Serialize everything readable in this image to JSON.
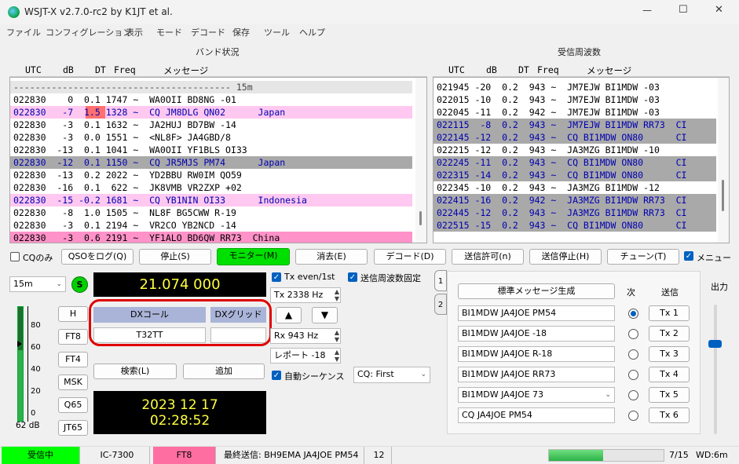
{
  "window": {
    "title": "WSJT-X   v2.7.0-rc2   by K1JT et al.",
    "minimize": "—",
    "maximize": "☐",
    "close": "✕"
  },
  "menu": [
    "ファイル",
    "コンフィグレーション",
    "表示",
    "モード",
    "デコード",
    "保存",
    "ツール",
    "ヘルプ"
  ],
  "band_activity": {
    "title": "バンド状況",
    "headers": [
      "UTC",
      "dB",
      "DT",
      "Freq",
      "メッセージ"
    ],
    "separator": "---------------------------------------- 15m",
    "rows": [
      {
        "text": "022830    0  0.1 1747 ~  WA0OII BD8NG -01",
        "hl": "none"
      },
      {
        "text": "022830   -7  1.5 1328 ~  CQ JM8DLG QN02      Japan",
        "hl": "pink",
        "dt_red": true
      },
      {
        "text": "022830   -3  0.1 1632 ~  JA2HUJ BD7BW -14",
        "hl": "none"
      },
      {
        "text": "022830   -3  0.0 1551 ~  <NL8F> JA4GBD/8",
        "hl": "none"
      },
      {
        "text": "022830  -13  0.1 1041 ~  WA0OII YF1BLS OI33",
        "hl": "none"
      },
      {
        "text": "022830  -12  0.1 1150 ~  CQ JR5MJS PM74      Japan",
        "hl": "gray"
      },
      {
        "text": "022830  -13  0.2 2022 ~  YD2BBU RW0IM QO59",
        "hl": "none"
      },
      {
        "text": "022830  -16  0.1  622 ~  JK8VMB VR2ZXP +02",
        "hl": "none"
      },
      {
        "text": "022830  -15 -0.2 1681 ~  CQ YB1NIN OI33      Indonesia",
        "hl": "pink"
      },
      {
        "text": "022830   -8  1.0 1505 ~  NL8F BG5CWW R-19",
        "hl": "none"
      },
      {
        "text": "022830   -3  0.1 2194 ~  VR2CO YB2NCD -14",
        "hl": "none"
      },
      {
        "text": "022830   -3  0.6 2191 ~  YF1ALO BD6QW RR73  China",
        "hl": "hotpink"
      }
    ]
  },
  "rx_frequency": {
    "title": "受信周波数",
    "headers": [
      "UTC",
      "dB",
      "DT",
      "Freq",
      "メッセージ"
    ],
    "rows": [
      {
        "text": "021945 -20  0.2  943 ~  JM7EJW BI1MDW -03",
        "hl": "none"
      },
      {
        "text": "022015 -10  0.2  943 ~  JM7EJW BI1MDW -03",
        "hl": "none"
      },
      {
        "text": "022045 -11  0.2  942 ~  JM7EJW BI1MDW -03",
        "hl": "none"
      },
      {
        "text": "022115  -8  0.2  943 ~  JM7EJW BI1MDW RR73  CI",
        "hl": "gray"
      },
      {
        "text": "022145 -12  0.2  943 ~  CQ BI1MDW ON80      CI",
        "hl": "gray"
      },
      {
        "text": "022215 -12  0.2  943 ~  JA3MZG BI1MDW -10",
        "hl": "none"
      },
      {
        "text": "022245 -11  0.2  943 ~  CQ BI1MDW ON80      CI",
        "hl": "gray"
      },
      {
        "text": "022315 -14  0.2  943 ~  CQ BI1MDW ON80      CI",
        "hl": "gray"
      },
      {
        "text": "022345 -10  0.2  943 ~  JA3MZG BI1MDW -12",
        "hl": "none"
      },
      {
        "text": "022415 -16  0.2  942 ~  JA3MZG BI1MDW RR73  CI",
        "hl": "gray"
      },
      {
        "text": "022445 -12  0.2  943 ~  JA3MZG BI1MDW RR73  CI",
        "hl": "gray"
      },
      {
        "text": "022515 -15  0.2  943 ~  CQ BI1MDW ON80      CI",
        "hl": "gray"
      }
    ]
  },
  "controls": {
    "cq_only": "CQのみ",
    "log_qso": "QSOをログ(Q)",
    "stop": "停止(S)",
    "monitor": "モニター(M)",
    "erase": "消去(E)",
    "decode": "デコード(D)",
    "enable_tx": "送信許可(n)",
    "halt_tx": "送信停止(H)",
    "tune": "チューン(T)",
    "menus": "メニュー"
  },
  "band": "15m",
  "status_dot": "S",
  "frequency": "21.074 000",
  "meter": {
    "ticks": [
      "80",
      "60",
      "40",
      "20",
      "0"
    ],
    "db": "62 dB",
    "level_pct": 62
  },
  "mode_buttons": [
    "H",
    "FT8",
    "FT4",
    "MSK",
    "Q65",
    "JT65"
  ],
  "dx": {
    "call_label": "DXコール",
    "grid_label": "DXグリッド",
    "call": "T32TT",
    "grid": ""
  },
  "lookup": "検索(L)",
  "add": "追加",
  "date": "2023 12 17",
  "time": "02:28:52",
  "tx_even": "Tx even/1st",
  "hold_tx": "送信周波数固定",
  "tx_freq": "Tx  2338  Hz",
  "rx_freq": "Rx  943  Hz",
  "report": "レポート -18",
  "auto_seq": "自動シーケンス",
  "cq_select": "CQ: First",
  "tabs": [
    "1",
    "2"
  ],
  "generate": "標準メッセージ生成",
  "next": "次",
  "send": "送信",
  "messages": [
    {
      "text": "BI1MDW JA4JOE PM54",
      "tx": "Tx 1",
      "selected": true
    },
    {
      "text": "BI1MDW JA4JOE -18",
      "tx": "Tx 2",
      "selected": false
    },
    {
      "text": "BI1MDW JA4JOE R-18",
      "tx": "Tx 3",
      "selected": false
    },
    {
      "text": "BI1MDW JA4JOE RR73",
      "tx": "Tx 4",
      "selected": false
    },
    {
      "text": "BI1MDW JA4JOE 73",
      "tx": "Tx 5",
      "selected": false
    },
    {
      "text": "CQ JA4JOE PM54",
      "tx": "Tx 6",
      "selected": false
    }
  ],
  "power_label": "出力",
  "statusbar": {
    "receiving": "受信中",
    "rig": "IC-7300",
    "mode": "FT8",
    "last_tx": "最終送信: BH9EMA JA4JOE PM54",
    "count": "12",
    "progress": "7/15",
    "wd": "WD:6m",
    "progress_fraction": 0.47
  },
  "colors": {
    "pink": "#ffc8f0",
    "hotpink": "#ff92c8",
    "gray": "#a9a9a9",
    "monitor": "#00e000",
    "red_outline": "#e00000",
    "blue_text": "#0000b0"
  }
}
